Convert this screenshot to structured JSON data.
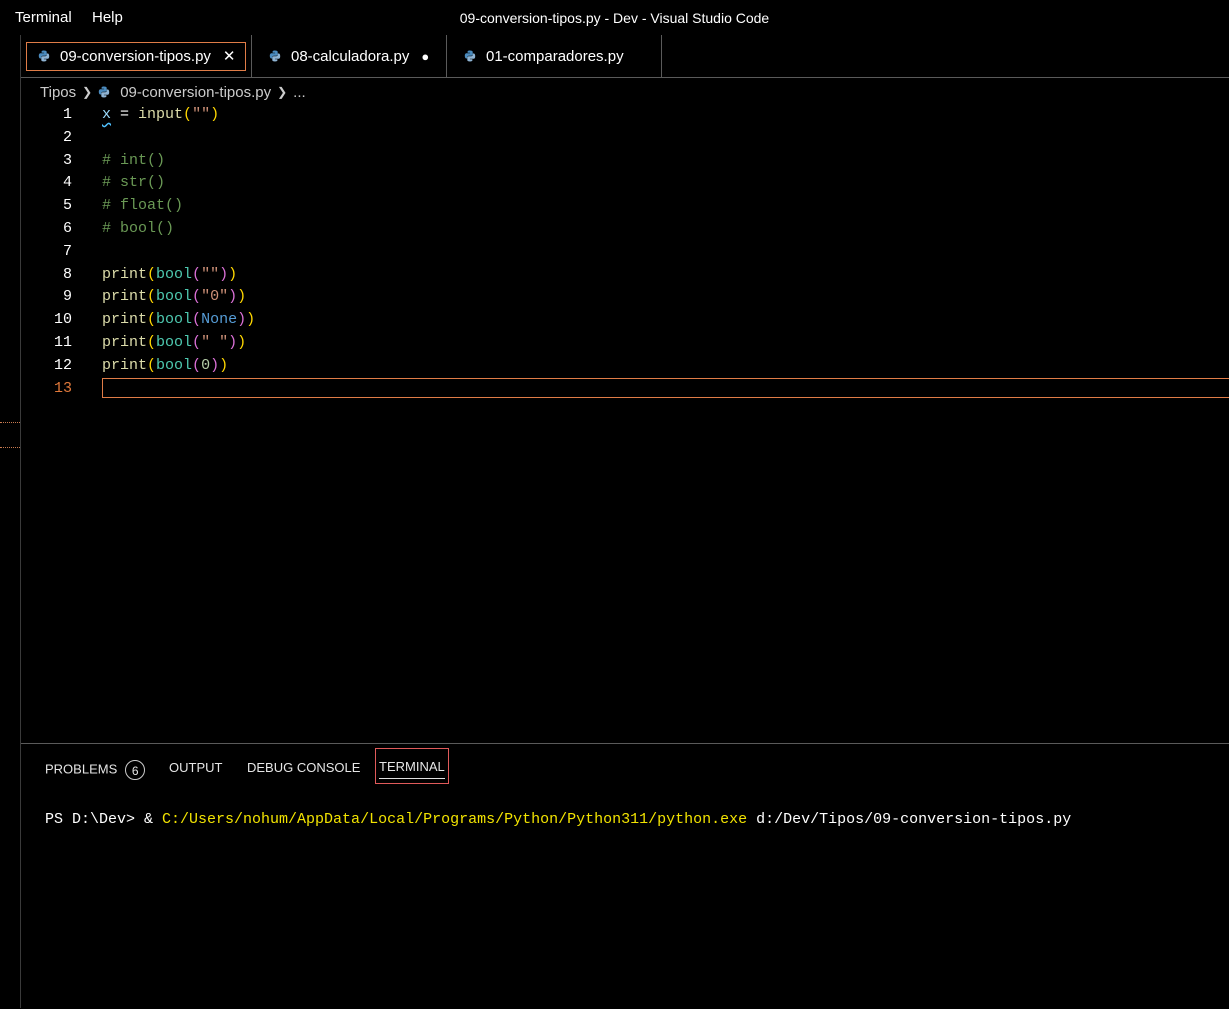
{
  "menu": {
    "terminal": "Terminal",
    "help": "Help"
  },
  "window_title": "09-conversion-tipos.py - Dev - Visual Studio Code",
  "tabs": [
    {
      "label": "09-conversion-tipos.py",
      "close": "✕",
      "icon": "python-icon"
    },
    {
      "label": "08-calculadora.py",
      "modified": "●",
      "icon": "python-icon"
    },
    {
      "label": "01-comparadores.py",
      "icon": "python-icon"
    }
  ],
  "breadcrumb": {
    "folder": "Tipos",
    "file": "09-conversion-tipos.py",
    "more": "..."
  },
  "editor": {
    "line_numbers": [
      "1",
      "2",
      "3",
      "4",
      "5",
      "6",
      "7",
      "8",
      "9",
      "10",
      "11",
      "12",
      "13"
    ],
    "lines": {
      "l1_var": "x",
      "l1_eq": " = ",
      "l1_fn": "input",
      "l1_open": "(",
      "l1_str": "\"\"",
      "l1_close": ")",
      "l3": "# int()",
      "l4": "# str()",
      "l5": "# float()",
      "l6": "# bool()",
      "print": "print",
      "bool": "bool",
      "open": "(",
      "close": ")",
      "l8_arg": "\"\"",
      "l9_arg": "\"0\"",
      "l10_arg": "None",
      "l11_arg": "\" \"",
      "l12_arg": "0"
    }
  },
  "panel": {
    "tabs": [
      "PROBLEMS",
      "OUTPUT",
      "DEBUG CONSOLE",
      "TERMINAL"
    ],
    "problems_count": "6",
    "terminal": {
      "prompt": "PS D:\\Dev> & ",
      "exe": "C:/Users/nohum/AppData/Local/Programs/Python/Python311/python.exe",
      "arg": " d:/Dev/Tipos/09-conversion-tipos.py"
    }
  },
  "colors": {
    "accent_focus": "#e07c47",
    "terminal_active_border": "#e05a5a",
    "background": "#000000"
  }
}
